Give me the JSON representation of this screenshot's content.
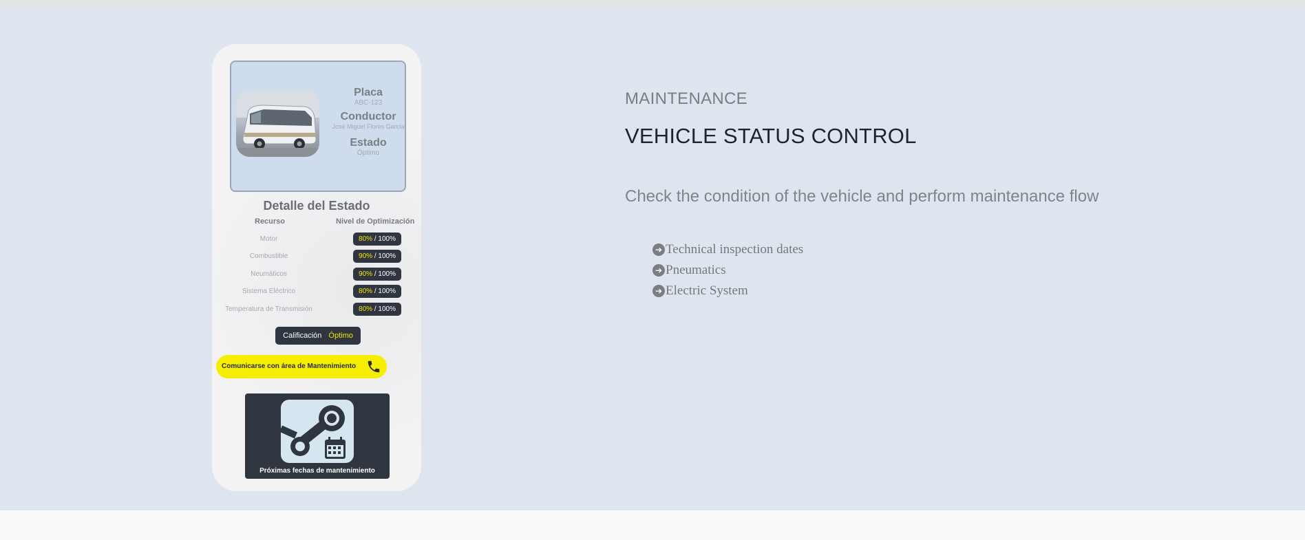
{
  "phone": {
    "card": {
      "plate_label": "Placa",
      "plate_value": "ABC-123",
      "driver_label": "Conductor",
      "driver_value": "José Miguel Flores García",
      "status_label": "Estado",
      "status_value": "Óptimo"
    },
    "detail_title": "Detalle del Estado",
    "col_resource": "Recurso",
    "col_level": "Nivel de Optimización",
    "resources": [
      {
        "name": "Motor",
        "pct": "80%",
        "total": " / 100%"
      },
      {
        "name": "Combustible",
        "pct": "90%",
        "total": " / 100%"
      },
      {
        "name": "Neumáticos",
        "pct": "90%",
        "total": " / 100%"
      },
      {
        "name": "Sistema Eléctrico",
        "pct": "80%",
        "total": " / 100%"
      },
      {
        "name": "Temperatura de Transmisión",
        "pct": "80%",
        "total": " / 100%"
      }
    ],
    "rating_label": "Calificación",
    "rating_value": "Óptimo",
    "contact_label": "Comunicarse con área de Mantenimiento",
    "maintenance_label": "Próximas fechas de mantenimiento",
    "icons": {
      "phone": "phone-icon",
      "maintenance": "wrench-calendar-icon",
      "bus": "bus-photo"
    }
  },
  "content": {
    "eyebrow": "MAINTENANCE",
    "heading": "VEHICLE STATUS CONTROL",
    "description": "Check the condition of the vehicle and perform maintenance flow",
    "features": [
      "Technical inspection dates",
      "Pneumatics",
      "Electric System"
    ],
    "feature_icon": "arrow-circle-icon"
  },
  "colors": {
    "section_bg": "#dfe5ef",
    "badge_bg": "#2f3640",
    "accent_yellow": "#f5ee00",
    "heading": "#1c2430"
  }
}
